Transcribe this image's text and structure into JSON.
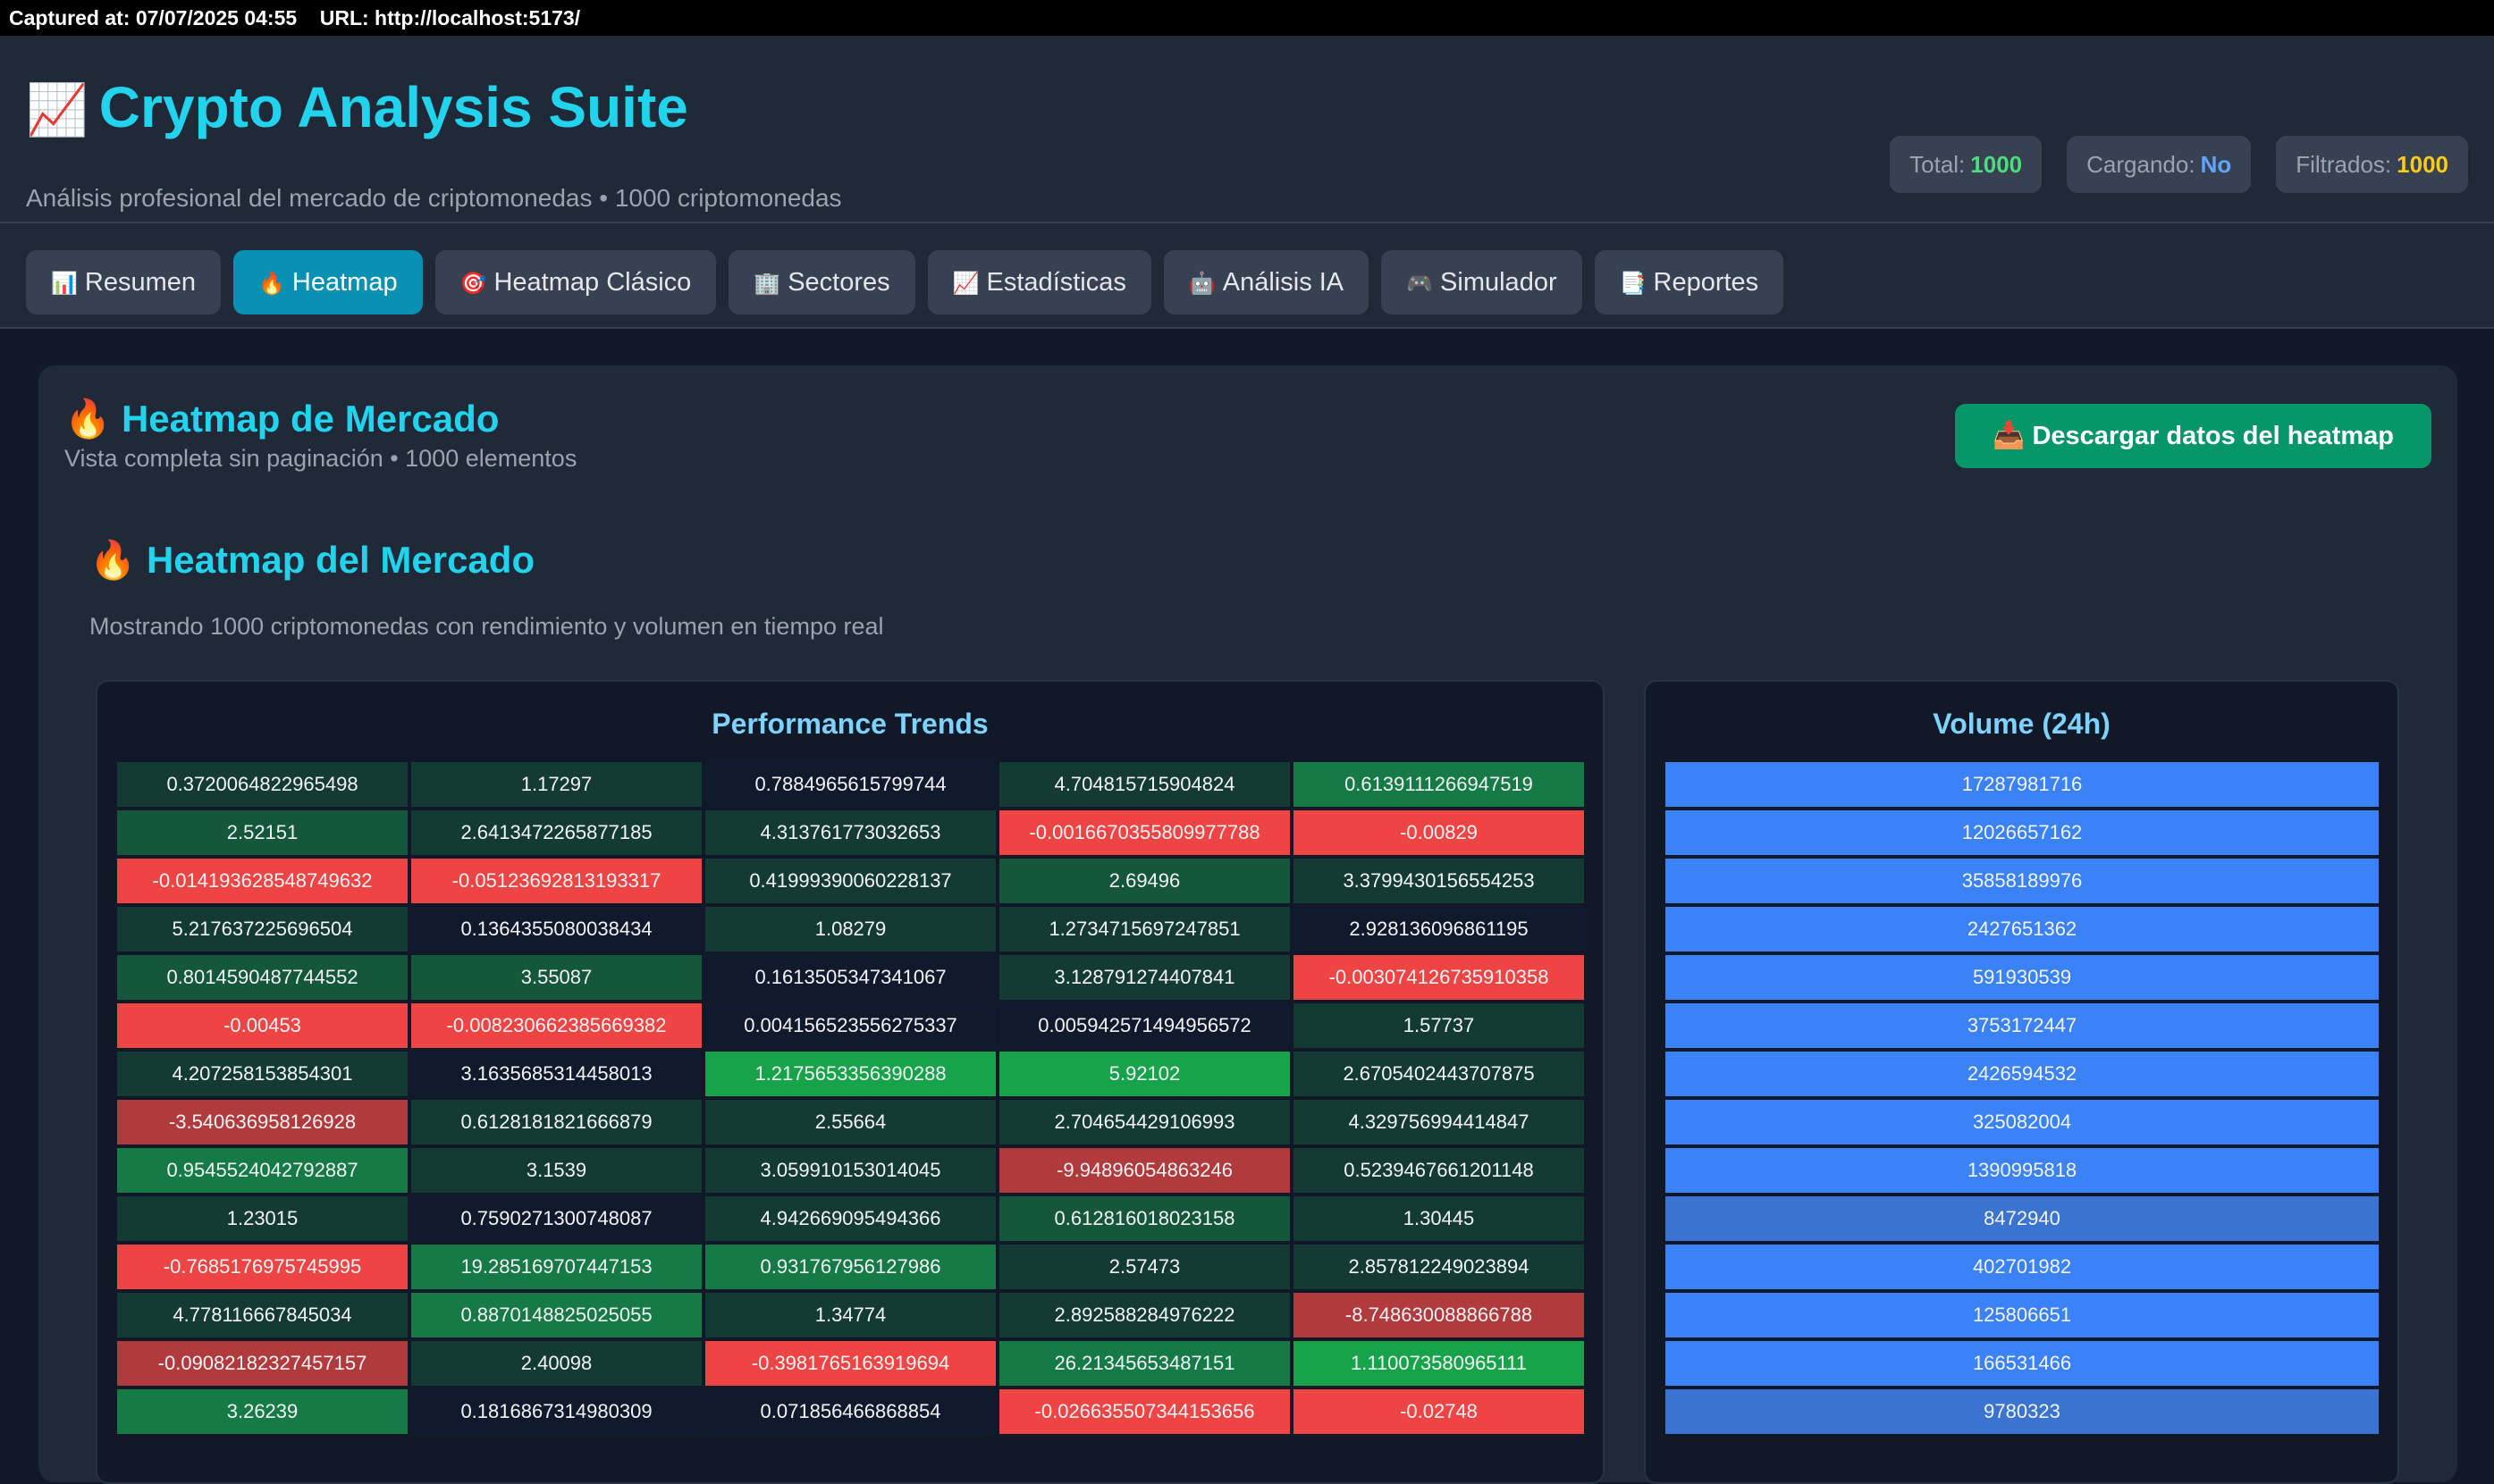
{
  "capture": {
    "text": "Captured at: 07/07/2025 04:55    URL: http://localhost:5173/"
  },
  "header": {
    "icon": "chart-increasing-emoji",
    "title": "Crypto Analysis Suite",
    "subtitle": "Análisis profesional del mercado de criptomonedas • 1000 criptomonedas",
    "stats": [
      {
        "label": "Total:",
        "value": "1000",
        "color": "#4ade80"
      },
      {
        "label": "Cargando:",
        "value": "No",
        "color": "#60a5fa"
      },
      {
        "label": "Filtrados:",
        "value": "1000",
        "color": "#facc15"
      }
    ]
  },
  "nav": {
    "tabs": [
      {
        "icon": "📊",
        "label": "Resumen"
      },
      {
        "icon": "🔥",
        "label": "Heatmap"
      },
      {
        "icon": "🎯",
        "label": "Heatmap Clásico"
      },
      {
        "icon": "🏢",
        "label": "Sectores"
      },
      {
        "icon": "📈",
        "label": "Estadísticas"
      },
      {
        "icon": "🤖",
        "label": "Análisis IA"
      },
      {
        "icon": "🎮",
        "label": "Simulador"
      },
      {
        "icon": "📑",
        "label": "Reportes"
      }
    ],
    "active_index": 1
  },
  "panel": {
    "icon": "🔥",
    "title": "Heatmap de Mercado",
    "subtitle": "Vista completa sin paginación • 1000 elementos",
    "download_icon": "📥",
    "download_label": "Descargar datos del heatmap"
  },
  "heatmap": {
    "icon": "🔥",
    "title": "Heatmap del Mercado",
    "description": "Mostrando 1000 criptomonedas con rendimiento y volumen en tiempo real",
    "performance_title": "Performance Trends",
    "volume_title": "Volume (24h)",
    "colors": {
      "neg_strong": "#ef4444",
      "neg_dark": "#b13a3d",
      "pos_bright": "#16a34a",
      "pos_mid": "#157a45",
      "pos_dim": "#14573a",
      "pos_dark": "#143a34",
      "neutral": "#111a2d",
      "volume": "#3b82f6",
      "volume_dim": "#3a74d0"
    },
    "performance_rows": [
      [
        "0.3720064822965498",
        "1.17297",
        "0.7884965615799744",
        "4.704815715904824",
        "0.6139111266947519"
      ],
      [
        "2.52151",
        "2.6413472265877185",
        "4.313761773032653",
        "-0.0016670355809977788",
        "-0.00829"
      ],
      [
        "-0.014193628548749632",
        "-0.05123692813193317",
        "0.41999390060228137",
        "2.69496",
        "3.3799430156554253"
      ],
      [
        "5.217637225696504",
        "0.1364355080038434",
        "1.08279",
        "1.2734715697247851",
        "2.928136096861195"
      ],
      [
        "0.8014590487744552",
        "3.55087",
        "0.1613505347341067",
        "3.128791274407841",
        "-0.003074126735910358"
      ],
      [
        "-0.00453",
        "-0.008230662385669382",
        "0.004156523556275337",
        "0.005942571494956572",
        "1.57737"
      ],
      [
        "4.207258153854301",
        "3.1635685314458013",
        "1.2175653356390288",
        "5.92102",
        "2.6705402443707875"
      ],
      [
        "-3.540636958126928",
        "0.6128181821666879",
        "2.55664",
        "2.704654429106993",
        "4.329756994414847"
      ],
      [
        "0.9545524042792887",
        "3.1539",
        "3.059910153014045",
        "-9.94896054863246",
        "0.5239467661201148"
      ],
      [
        "1.23015",
        "0.7590271300748087",
        "4.942669095494366",
        "0.612816018023158",
        "1.30445"
      ],
      [
        "-0.7685176975745995",
        "19.285169707447153",
        "0.931767956127986",
        "2.57473",
        "2.857812249023894"
      ],
      [
        "4.778116667845034",
        "0.8870148825025055",
        "1.34774",
        "2.892588284976222",
        "-8.748630088866788"
      ],
      [
        "-0.09082182327457157",
        "2.40098",
        "-0.3981765163919694",
        "26.21345653487151",
        "1.110073580965111"
      ],
      [
        "3.26239",
        "0.1816867314980309",
        "0.071856466868854",
        "-0.026635507344153656",
        "-0.02748"
      ]
    ],
    "performance_tones": [
      [
        "pos_dark",
        "pos_dark",
        "neutral",
        "pos_dark",
        "pos_mid"
      ],
      [
        "pos_dim",
        "pos_dark",
        "pos_dark",
        "neg_strong",
        "neg_strong"
      ],
      [
        "neg_strong",
        "neg_strong",
        "pos_dark",
        "pos_dim",
        "pos_dark"
      ],
      [
        "pos_dark",
        "neutral",
        "pos_dark",
        "pos_dark",
        "neutral"
      ],
      [
        "pos_dim",
        "pos_dim",
        "neutral",
        "pos_dark",
        "neg_strong"
      ],
      [
        "neg_strong",
        "neg_strong",
        "neutral",
        "neutral",
        "pos_dark"
      ],
      [
        "pos_dark",
        "neutral",
        "pos_bright",
        "pos_bright",
        "pos_dark"
      ],
      [
        "neg_dark",
        "pos_dark",
        "pos_dark",
        "pos_dark",
        "pos_dark"
      ],
      [
        "pos_mid",
        "pos_dark",
        "pos_dark",
        "neg_dark",
        "pos_dark"
      ],
      [
        "pos_dark",
        "neutral",
        "pos_dark",
        "pos_dim",
        "pos_dark"
      ],
      [
        "neg_strong",
        "pos_mid",
        "pos_mid",
        "pos_dark",
        "pos_dark"
      ],
      [
        "pos_dark",
        "pos_mid",
        "pos_dark",
        "pos_dark",
        "neg_dark"
      ],
      [
        "neg_dark",
        "pos_dark",
        "neg_strong",
        "pos_mid",
        "pos_bright"
      ],
      [
        "pos_mid",
        "neutral",
        "neutral",
        "neg_strong",
        "neg_strong"
      ]
    ],
    "volume_rows": [
      "17287981716",
      "12026657162",
      "35858189976",
      "2427651362",
      "591930539",
      "3753172447",
      "2426594532",
      "325082004",
      "1390995818",
      "8472940",
      "402701982",
      "125806651",
      "166531466",
      "9780323"
    ],
    "volume_tones": [
      "volume",
      "volume",
      "volume",
      "volume",
      "volume",
      "volume",
      "volume",
      "volume",
      "volume",
      "volume_dim",
      "volume",
      "volume",
      "volume",
      "volume_dim"
    ]
  }
}
